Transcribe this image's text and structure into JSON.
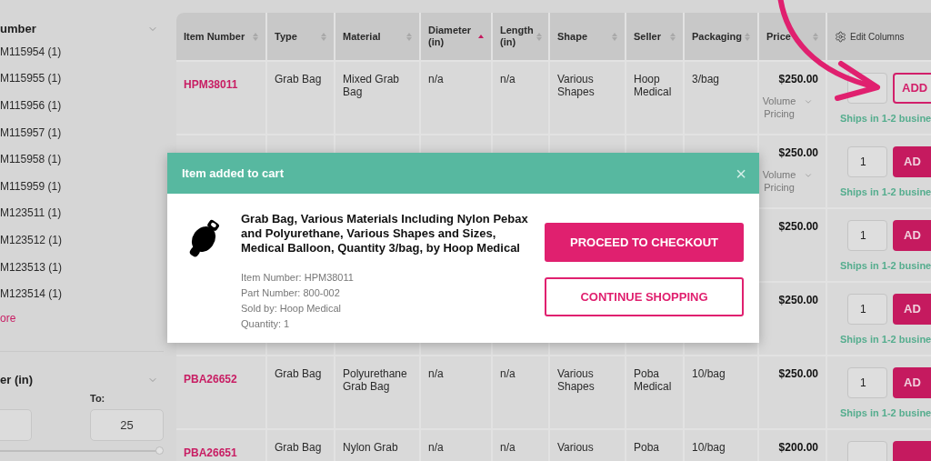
{
  "sidebar": {
    "filters": [
      {
        "title": "umber",
        "items": [
          "M115954 (1)",
          "M115955 (1)",
          "M115956 (1)",
          "M115957 (1)",
          "M115958 (1)",
          "M115959 (1)",
          "M123511 (1)",
          "M123512 (1)",
          "M123513 (1)",
          "M123514 (1)"
        ],
        "more_link": "ore"
      },
      {
        "title": "er (in)",
        "to_label": "To:",
        "to_value": "25",
        "level": 1
      }
    ]
  },
  "table": {
    "columns": [
      {
        "label": "Item Number",
        "kind": "sort",
        "sorted": false
      },
      {
        "label": "Type",
        "kind": "sort",
        "sorted": false
      },
      {
        "label": "Material",
        "kind": "sort",
        "sorted": false
      },
      {
        "label": "Diameter (in)",
        "kind": "sort",
        "sorted": true
      },
      {
        "label": "Length (in)",
        "kind": "sort",
        "sorted": false
      },
      {
        "label": "Shape",
        "kind": "sort",
        "sorted": false
      },
      {
        "label": "Seller",
        "kind": "sort",
        "sorted": false
      },
      {
        "label": "Packaging",
        "kind": "sort",
        "sorted": false
      },
      {
        "label": "Price",
        "kind": "sort",
        "sorted": false
      },
      {
        "label": "Edit Columns",
        "kind": "edit"
      }
    ],
    "rows": [
      {
        "cells": [
          "HPM38011",
          "Grab Bag",
          "Mixed Grab Bag",
          "n/a",
          "n/a",
          "Various Shapes",
          "Hoop Medical",
          "3/bag"
        ],
        "price": "$250.00",
        "volume_pricing": "Volume Pricing",
        "add_button": {
          "label": "ADD",
          "kind": "outline"
        },
        "shipping": "Ships in 1-2 busine"
      },
      {
        "price": "$250.00",
        "volume_pricing": "Volume Pricing",
        "quantity": "1",
        "add_button": {
          "label": "AD",
          "kind": "filled"
        },
        "shipping": "Ships in 1-2 busine"
      },
      {
        "price": "$250.00",
        "quantity": "1",
        "add_button": {
          "label": "AD",
          "kind": "filled"
        },
        "shipping": "Ships in 1-2 busine"
      },
      {
        "price": "$250.00",
        "quantity": "1",
        "add_button": {
          "label": "AD",
          "kind": "filled"
        },
        "shipping": "Ships in 1-2 busine"
      },
      {
        "cells": [
          "PBA26652",
          "Grab Bag",
          "Polyurethane Grab Bag",
          "n/a",
          "n/a",
          "Various Shapes",
          "Poba Medical",
          "10/bag"
        ],
        "price": "$250.00",
        "quantity": "1",
        "add_button": {
          "label": "AD",
          "kind": "filled"
        },
        "shipping": "Ships in 1-2 busine"
      },
      {
        "cells": [
          "PBA26651",
          "Grab Bag",
          "Nylon Grab",
          "n/a",
          "n/a",
          "Various",
          "Poba",
          "10/bag"
        ],
        "price": "$200.00",
        "add_button": {
          "kind": "filled"
        }
      }
    ]
  },
  "modal": {
    "title": "Item added to cart",
    "close": "×",
    "product_title": "Grab Bag, Various Materials Including Nylon Pebax and Polyurethane, Various Shapes and Sizes, Medical Balloon, Quantity 3/bag, by Hoop Medical",
    "details": [
      "Item Number: HPM38011",
      "Part Number: 800-002",
      "Sold by: Hoop Medical",
      "Quantity: 1"
    ],
    "buttons": [
      {
        "label": "PROCEED TO CHECKOUT",
        "kind": "primary"
      },
      {
        "label": "CONTINUE SHOPPING",
        "kind": "secondary"
      }
    ]
  }
}
